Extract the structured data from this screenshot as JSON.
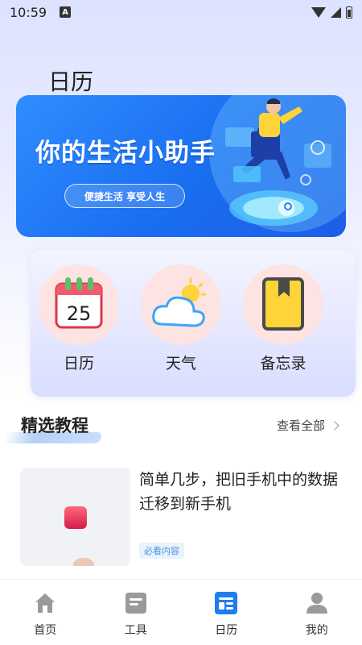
{
  "status_bar": {
    "time": "10:59",
    "indicator": "A"
  },
  "page_title": "日历",
  "banner": {
    "title": "你的生活小助手",
    "subtitle": "便捷生活  享受人生"
  },
  "quick_entries": [
    {
      "label": "日历",
      "icon": "calendar-icon",
      "day": "25"
    },
    {
      "label": "天气",
      "icon": "weather-icon"
    },
    {
      "label": "备忘录",
      "icon": "memo-icon"
    }
  ],
  "section": {
    "title": "精选教程",
    "more_label": "查看全部"
  },
  "article": {
    "title": "简单几步，把旧手机中的数据迁移到新手机",
    "tag": "必看内容"
  },
  "bottom_nav": [
    {
      "label": "首页",
      "icon": "home-icon",
      "active": false
    },
    {
      "label": "工具",
      "icon": "tools-icon",
      "active": false
    },
    {
      "label": "日历",
      "icon": "calendar-tab-icon",
      "active": true
    },
    {
      "label": "我的",
      "icon": "profile-icon",
      "active": false
    }
  ],
  "colors": {
    "accent": "#1e7ef0",
    "inactive_icon": "#9a9a9a",
    "pink_circle": "#fde3e1"
  }
}
